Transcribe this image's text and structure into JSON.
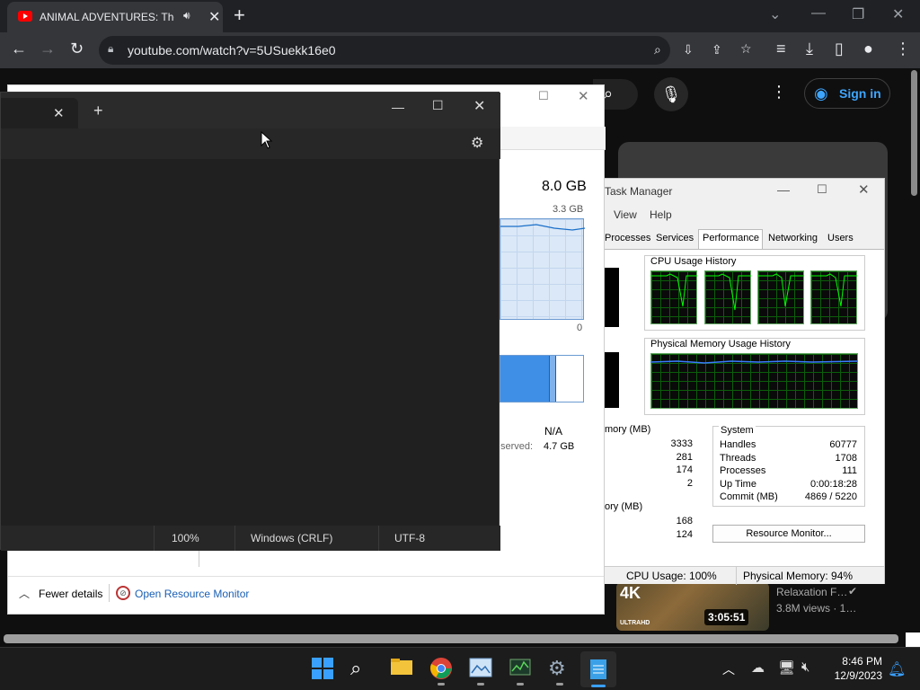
{
  "browser": {
    "tab_title": "ANIMAL ADVENTURES: The /",
    "url": "youtube.com/watch?v=5USuekk16e0"
  },
  "youtube": {
    "signin_label": "Sign in",
    "video": {
      "title": "Relaxation F…",
      "views": "3.8M views · 1…",
      "duration": "3:05:51",
      "badge_main": "4K",
      "badge_sub": "ULTRAHD"
    }
  },
  "taskmanager_back": {
    "memory_total": "8.0 GB",
    "graph_max": "3.3 GB",
    "graph_min": "0",
    "na_value": "N/A",
    "reserved_label": "served:",
    "reserved_value": "4.7 GB",
    "fewer_details": "Fewer details",
    "open_resource_monitor": "Open Resource Monitor"
  },
  "taskmanager_front": {
    "title": "Task Manager",
    "menu": [
      "View",
      "Help"
    ],
    "tabs": [
      "Processes",
      "Services",
      "Performance",
      "Networking",
      "Users"
    ],
    "cpu_history_label": "CPU Usage History",
    "mem_history_label": "Physical Memory Usage History",
    "memory_section": "mory (MB)",
    "memory_values": [
      "3333",
      "281",
      "174",
      "2"
    ],
    "memory2_section": "ory (MB)",
    "memory2_values": [
      "168",
      "124"
    ],
    "system": {
      "heading": "System",
      "rows": [
        {
          "label": "Handles",
          "value": "60777"
        },
        {
          "label": "Threads",
          "value": "1708"
        },
        {
          "label": "Processes",
          "value": "111"
        },
        {
          "label": "Up Time",
          "value": "0:00:18:28"
        },
        {
          "label": "Commit (MB)",
          "value": "4869 / 5220"
        }
      ]
    },
    "resource_monitor_btn": "Resource Monitor...",
    "status_cpu": "CPU Usage: 100%",
    "status_mem": "Physical Memory: 94%"
  },
  "notepad": {
    "zoom": "100%",
    "line_ending": "Windows (CRLF)",
    "encoding": "UTF-8"
  },
  "taskbar": {
    "time": "8:46 PM",
    "date": "12/9/2023"
  },
  "colors": {
    "chrome_dark": "#202124",
    "youtube_bg": "#0f0f0f",
    "accent_blue": "#3ea6ff",
    "graph_green": "#00ff00"
  }
}
